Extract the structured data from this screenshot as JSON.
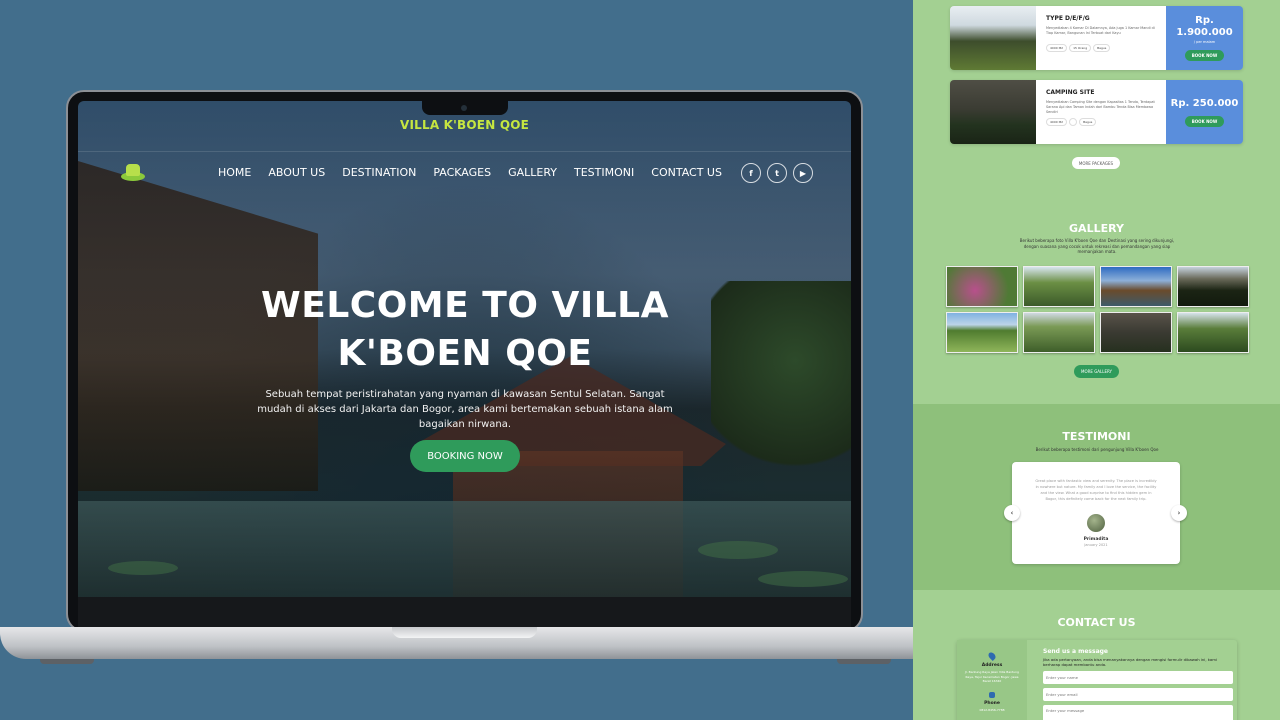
{
  "site": {
    "brand": "VILLA K'BOEN QOE",
    "nav": [
      "HOME",
      "ABOUT US",
      "DESTINATION",
      "PACKAGES",
      "GALLERY",
      "TESTIMONI",
      "CONTACT US"
    ],
    "social_icons": [
      "facebook-icon",
      "twitter-icon",
      "youtube-icon"
    ],
    "hero": {
      "title": "WELCOME TO VILLA K'BOEN QOE",
      "subtitle": "Sebuah tempat peristirahatan yang nyaman di kawasan Sentul Selatan. Sangat mudah di akses dari Jakarta dan Bogor, area kami bertemakan sebuah istana alam bagaikan nirwana.",
      "button": "BOOKING NOW"
    }
  },
  "mobile": {
    "packages": [
      {
        "name": "TYPE D/E/F/G",
        "desc": "Menyediakan 4 Kamar Di Dalamnya, Ada juga 1 Kamar Mandi di Tiap Kamar, Bangunan Ini Terbuat dari Kayu",
        "chips": [
          "4000 M2",
          "15 Orang",
          "Bagus"
        ],
        "price": "Rp. 1.900.000",
        "price_note": "/ per malam",
        "button": "BOOK NOW"
      },
      {
        "name": "CAMPING SITE",
        "desc": "Menyediakan Camping Site dengan Kapasitas 1 Tenda, Terdapat Sarana Api dan Taman Indah dari Bambu Tenda Bisa Membawa Sendiri",
        "chips": [
          "4000 M2",
          "",
          "Bagus"
        ],
        "price": "Rp. 250.000",
        "price_note": "",
        "button": "BOOK NOW"
      }
    ],
    "more_packages": "MORE PACKAGES",
    "gallery": {
      "title": "GALLERY",
      "subtitle": "Berikut beberapa foto Villa K'boen Qoe dan Destinasi yang sering dikunjungi, dengan suasana yang cocok untuk rekreasi dan pemandangan yang siap memanjakan mata.",
      "more": "MORE GALLERY"
    },
    "testimoni": {
      "title": "TESTIMONI",
      "subtitle": "Berikut beberapa testimoni dari pengunjung Villa K'boen Qoe",
      "quote": "Great place with fantastic view and serenity. The place is incredibly in nowhere but nature. My family and I love the service, the facility and the view. What a good surprise to find this hidden gem in Bogor, this definitely come back for the next family trip.",
      "name": "Primadita",
      "date": "January 2021"
    },
    "contact": {
      "title": "CONTACT US",
      "address_label": "Address",
      "address": "Jl. Bantung Raya Jalan Villa Bantung Raya, Tajur Kecamatan Bogor, Jawa Barat 16340",
      "phone_label": "Phone",
      "phone": "0812-8456-7788",
      "form_title": "Send us a message",
      "form_sub": "Jika ada pertanyaan, anda bisa menanyakannya dengan mengisi formulir dibawah ini, kami berharap dapat membantu anda.",
      "name_ph": "Enter your name",
      "email_ph": "Enter your email",
      "msg_ph": "Enter your message"
    }
  },
  "colors": {
    "brand_yellow": "#c6e640",
    "green": "#2f9b5b",
    "price_blue": "#5a8edc",
    "panel_bg": "#a3d092",
    "page_bg": "#426e8c"
  }
}
